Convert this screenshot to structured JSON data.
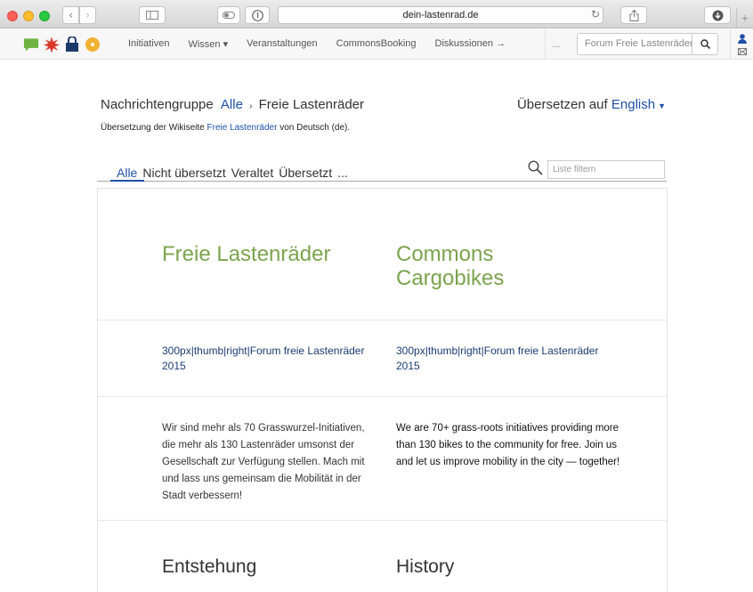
{
  "browser": {
    "url": "dein-lastenrad.de",
    "icons": [
      "back-icon",
      "forward-icon",
      "sidebar-icon",
      "reader-icon",
      "info-icon",
      "reload-icon",
      "share-icon",
      "download-icon",
      "new-tab-icon"
    ]
  },
  "navbar": {
    "logos": [
      "speech-bubble-logo",
      "star-burst-logo",
      "bag-logo",
      "coin-logo"
    ],
    "links": [
      "Initiativen",
      "Wissen ▾",
      "Veranstaltungen",
      "CommonsBooking",
      "Diskussionen →"
    ],
    "more": "...",
    "search_placeholder": "Forum Freie Lastenräder",
    "colors": {
      "bubble": "#6cb33f",
      "star": "#d9382b",
      "bag": "#1b3a6b",
      "coin": "#f2b233"
    }
  },
  "header": {
    "group_label": "Nachrichtengruppe",
    "group_link": "Alle",
    "separator": "›",
    "page_name": "Freie Lastenräder",
    "translate_label": "Übersetzen auf",
    "translate_lang": "English"
  },
  "subtitle": {
    "prefix": "Übersetzung der Wikiseite",
    "link": "Freie Lastenräder",
    "suffix": "von Deutsch (de)."
  },
  "filter": {
    "tabs": [
      "Alle",
      "Nicht übersetzt",
      "Veraltet",
      "Übersetzt",
      "..."
    ],
    "active_tab": "Alle",
    "placeholder": "Liste filtern"
  },
  "rows": [
    {
      "de": "Freie Lastenräder",
      "en": "Commons Cargobikes"
    },
    {
      "de": "300px|thumb|right|Forum freie Lastenräder 2015",
      "en": "300px|thumb|right|Forum freie Lastenräder 2015"
    },
    {
      "de": "Wir sind mehr als 70 Grasswurzel-Initiativen, die mehr als 130 Lastenräder umsonst der Gesellschaft zur Verfügung stellen. Mach mit und lass uns gemeinsam die Mobilität in der Stadt verbessern!",
      "en": "We are 70+ grass-roots initiatives providing more than 130 bikes to the community for free. Join us and let us improve mobility in the city — together!"
    },
    {
      "de": "Entstehung",
      "en": "History"
    }
  ],
  "colors": {
    "link": "#1f4fa8",
    "heading_green": "#7ba34e"
  }
}
